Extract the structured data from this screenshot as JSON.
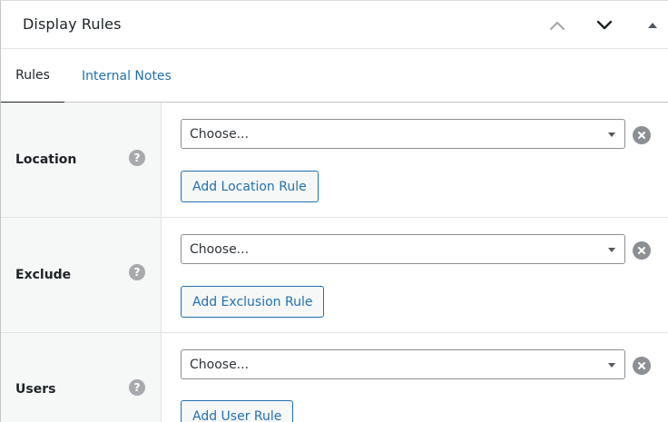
{
  "header": {
    "title": "Display Rules",
    "move_up_icon": "chevron-up-icon",
    "move_down_icon": "chevron-down-icon",
    "toggle_icon": "triangle-up-icon"
  },
  "tabs": [
    {
      "label": "Rules",
      "active": true
    },
    {
      "label": "Internal Notes",
      "active": false
    }
  ],
  "rows": [
    {
      "label": "Location",
      "help": "?",
      "select_value": "Choose...",
      "add_label": "Add Location Rule"
    },
    {
      "label": "Exclude",
      "help": "?",
      "select_value": "Choose...",
      "add_label": "Add Exclusion Rule"
    },
    {
      "label": "Users",
      "help": "?",
      "select_value": "Choose...",
      "add_label": "Add User Rule"
    }
  ],
  "colors": {
    "accent": "#2271b1",
    "label_bg": "#f6f7f7",
    "help_icon": "#a7aaad",
    "remove_icon": "#8c8f94"
  }
}
